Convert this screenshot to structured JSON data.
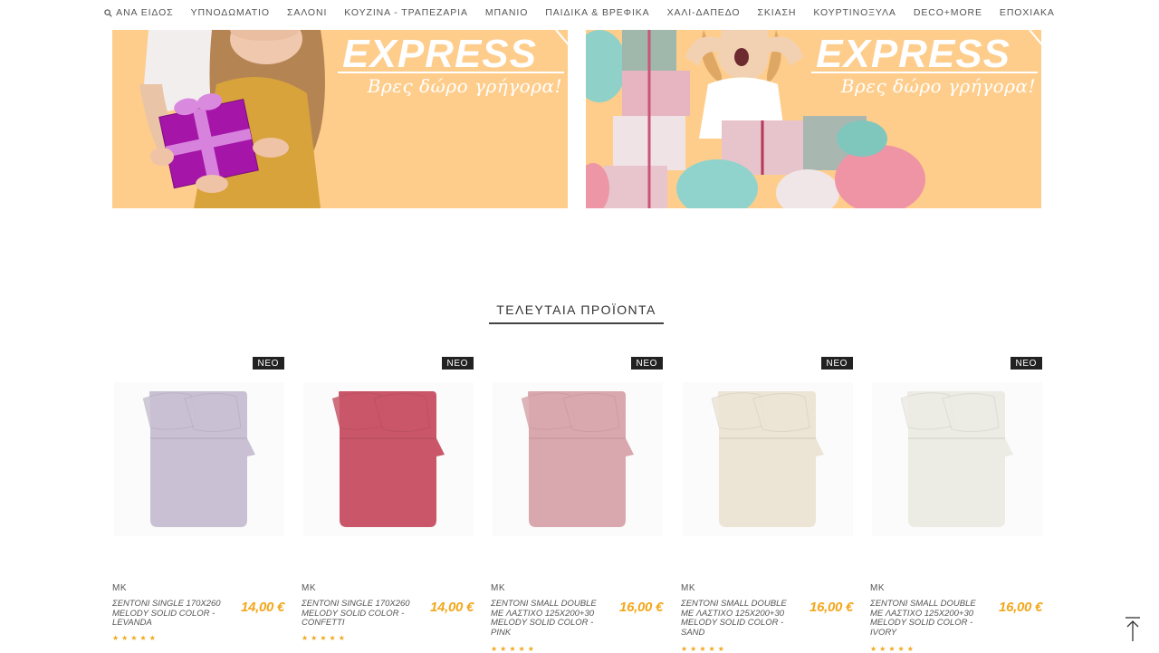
{
  "nav": {
    "items": [
      {
        "label": "ΑΝΑ ΕΙΔΟΣ",
        "icon": "search-icon"
      },
      {
        "label": "ΥΠΝΟΔΩΜΑΤΙΟ"
      },
      {
        "label": "ΣΑΛΟΝΙ"
      },
      {
        "label": "ΚΟΥΖΙΝΑ - ΤΡΑΠΕΖΑΡΙΑ"
      },
      {
        "label": "ΜΠΑΝΙΟ"
      },
      {
        "label": "ΠΑΙΔΙΚΑ & ΒΡΕΦΙΚΑ"
      },
      {
        "label": "ΧΑΛΙ-ΔΑΠΕΔΟ"
      },
      {
        "label": "ΣΚΙΑΣΗ"
      },
      {
        "label": "ΚΟΥΡΤΙΝΟΞΥΛΑ"
      },
      {
        "label": "DECO+MORE"
      },
      {
        "label": "ΕΠΟΧΙΑΚΑ"
      }
    ]
  },
  "banners": [
    {
      "title": "EXPRESS",
      "tagline": "Βρες δώρο γρήγορα!"
    },
    {
      "title": "EXPRESS",
      "tagline": "Βρες δώρο γρήγορα!"
    }
  ],
  "section": {
    "title": "ΤΕΛΕΥΤΑΙΑ ΠΡΟΪΟΝΤΑ"
  },
  "products": [
    {
      "badge": "ΝΕΟ",
      "brand": "MK",
      "name": "ΣΕΝΤΟΝΙ SINGLE 170X260 MELODY SOLID COLOR - LEVANDA",
      "price": "14,00 €",
      "rating": 5,
      "color": "#c9c1d3"
    },
    {
      "badge": "ΝΕΟ",
      "brand": "MK",
      "name": "ΣΕΝΤΟΝΙ SINGLE 170X260 MELODY SOLID COLOR - CONFETTI",
      "price": "14,00 €",
      "rating": 5,
      "color": "#c95769"
    },
    {
      "badge": "ΝΕΟ",
      "brand": "MK",
      "name": "ΣΕΝΤΟΝΙ SMALL DOUBLE ΜΕ ΛΑΣΤΙΧΟ 125X200+30 MELODY SOLID COLOR - PINK",
      "price": "16,00 €",
      "rating": 5,
      "color": "#d9a8ae"
    },
    {
      "badge": "ΝΕΟ",
      "brand": "MK",
      "name": "ΣΕΝΤΟΝΙ SMALL DOUBLE ΜΕ ΛΑΣΤΙΧΟ 125X200+30 MELODY SOLID COLOR - SAND",
      "price": "16,00 €",
      "rating": 5,
      "color": "#ece5d6"
    },
    {
      "badge": "ΝΕΟ",
      "brand": "MK",
      "name": "ΣΕΝΤΟΝΙ SMALL DOUBLE ΜΕ ΛΑΣΤΙΧΟ 125X200+30 MELODY SOLID COLOR - IVORY",
      "price": "16,00 €",
      "rating": 5,
      "color": "#ecebe4"
    }
  ],
  "colors": {
    "accent": "#f2a71b",
    "banner_bg": "#fecd8c",
    "badge_bg": "#222222"
  },
  "back_to_top": {
    "icon": "arrow-up-icon"
  }
}
